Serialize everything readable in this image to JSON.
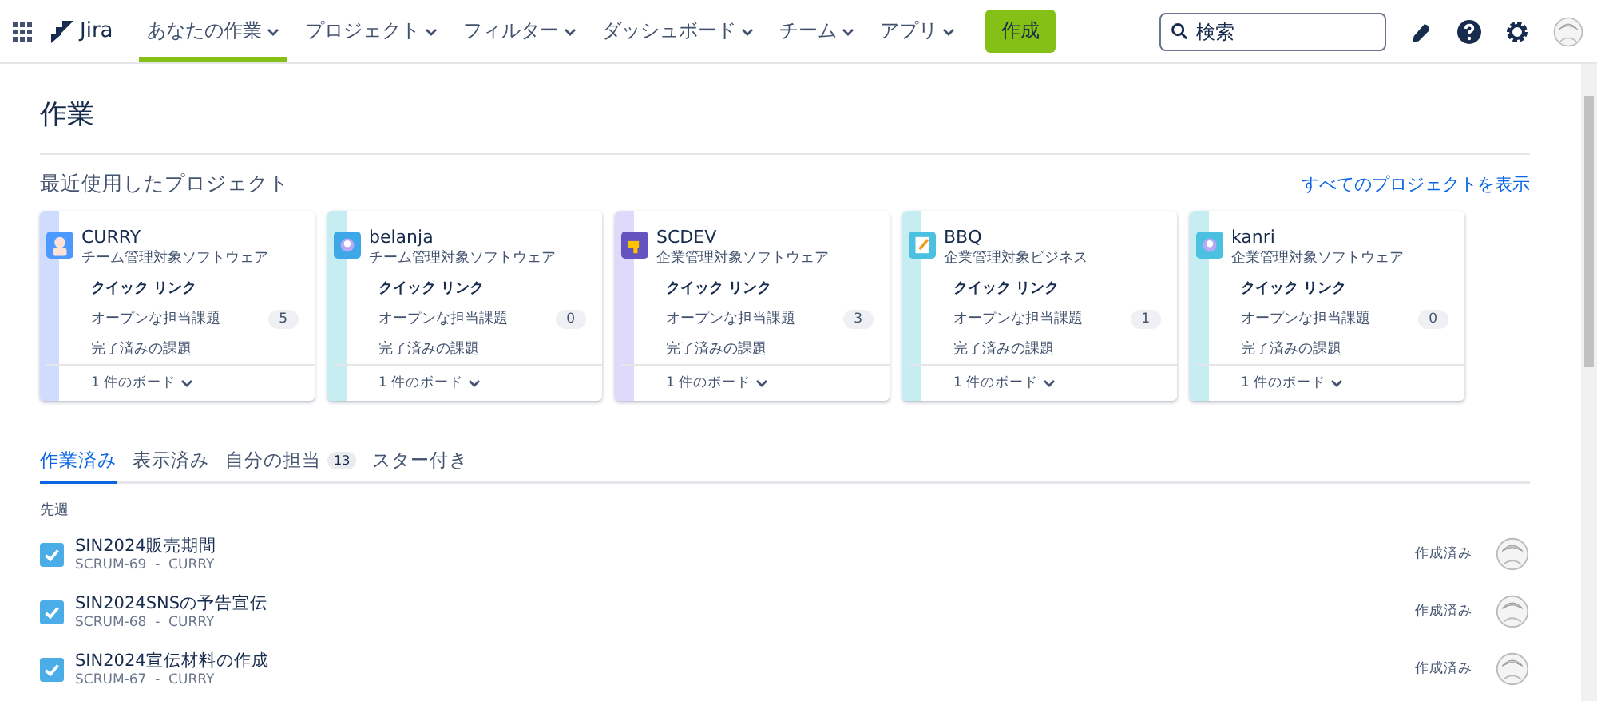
{
  "nav": {
    "product": "Jira",
    "items": [
      {
        "label": "あなたの作業",
        "selected": true
      },
      {
        "label": "プロジェクト",
        "selected": false
      },
      {
        "label": "フィルター",
        "selected": false
      },
      {
        "label": "ダッシュボード",
        "selected": false
      },
      {
        "label": "チーム",
        "selected": false
      },
      {
        "label": "アプリ",
        "selected": false
      }
    ],
    "create": "作成",
    "search": {
      "placeholder": "検索"
    }
  },
  "page_title": "作業",
  "recent": {
    "heading": "最近使用したプロジェクト",
    "view_all": "すべてのプロジェクトを表示",
    "projects": [
      {
        "name": "CURRY",
        "type": "チーム管理対象ソフトウェア",
        "color": "#cfdcfe",
        "quick_links": "クイック リンク",
        "open_label": "オープンな担当課題",
        "open_count": "5",
        "done_label": "完了済みの課題",
        "boards": "1 件のボード"
      },
      {
        "name": "belanja",
        "type": "チーム管理対象ソフトウェア",
        "color": "#c6eef2",
        "quick_links": "クイック リンク",
        "open_label": "オープンな担当課題",
        "open_count": "0",
        "done_label": "完了済みの課題",
        "boards": "1 件のボード"
      },
      {
        "name": "SCDEV",
        "type": "企業管理対象ソフトウェア",
        "color": "#e0d9fc",
        "quick_links": "クイック リンク",
        "open_label": "オープンな担当課題",
        "open_count": "3",
        "done_label": "完了済みの課題",
        "boards": "1 件のボード"
      },
      {
        "name": "BBQ",
        "type": "企業管理対象ビジネス",
        "color": "#c6eef2",
        "quick_links": "クイック リンク",
        "open_label": "オープンな担当課題",
        "open_count": "1",
        "done_label": "完了済みの課題",
        "boards": "1 件のボード"
      },
      {
        "name": "kanri",
        "type": "企業管理対象ソフトウェア",
        "color": "#c6eef2",
        "quick_links": "クイック リンク",
        "open_label": "オープンな担当課題",
        "open_count": "0",
        "done_label": "完了済みの課題",
        "boards": "1 件のボード"
      }
    ]
  },
  "tabs": [
    {
      "label": "作業済み",
      "selected": true
    },
    {
      "label": "表示済み",
      "selected": false
    },
    {
      "label": "自分の担当",
      "selected": false,
      "count": "13"
    },
    {
      "label": "スター付き",
      "selected": false
    }
  ],
  "group": "先週",
  "issues": [
    {
      "title": "SIN2024販売期間",
      "key": "SCRUM-69  -  CURRY",
      "status": "作成済み"
    },
    {
      "title": "SIN2024SNSの予告宣伝",
      "key": "SCRUM-68  -  CURRY",
      "status": "作成済み"
    },
    {
      "title": "SIN2024宣伝材料の作成",
      "key": "SCRUM-67  -  CURRY",
      "status": "作成済み"
    }
  ]
}
